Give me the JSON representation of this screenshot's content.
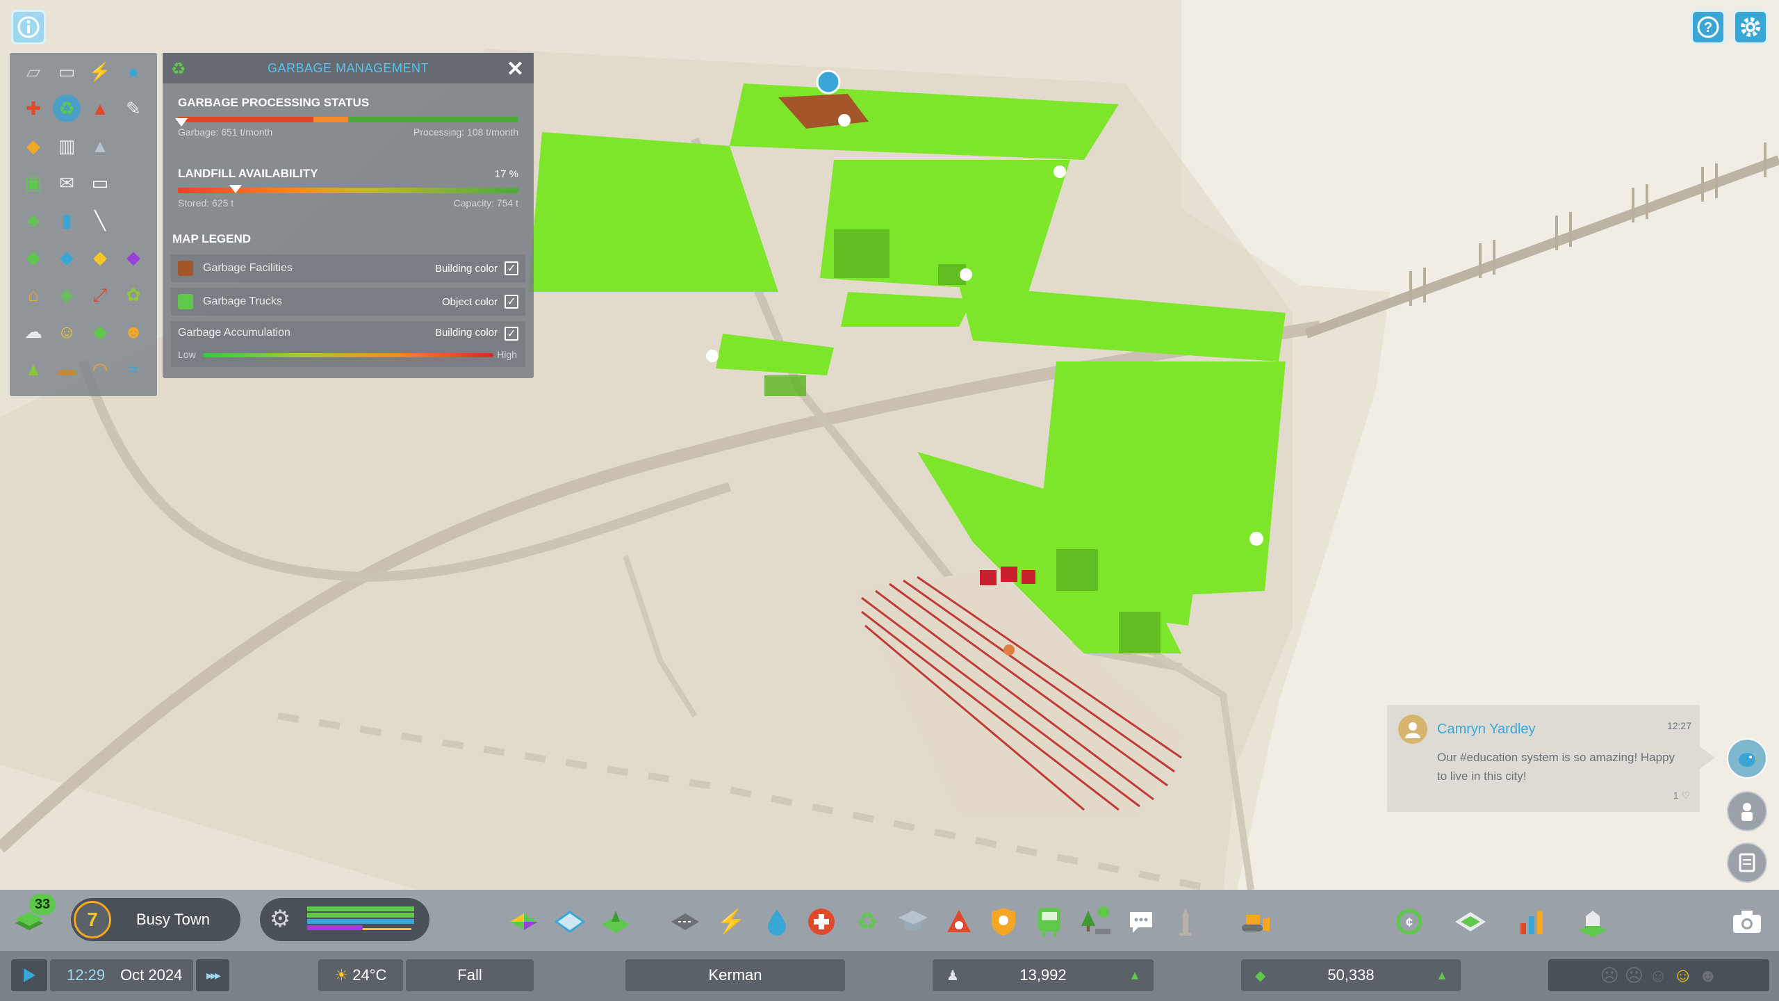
{
  "colors": {
    "accent": "#58c3ee",
    "garbage_facility": "#a4562b",
    "garbage_truck": "#5ec84a",
    "healthy_building": "#7de62a",
    "accumulation_low": "#2ecc40",
    "accumulation_high": "#d42a2a"
  },
  "top_buttons": {
    "info_icon": "info-icon",
    "help_icon": "help-icon",
    "settings_icon": "gear-icon"
  },
  "info_views": [
    [
      "road-icon",
      "transport-icon",
      "electricity-icon",
      "water-icon"
    ],
    [
      "health-icon",
      "garbage-icon",
      "fire-icon",
      "maintenance-icon"
    ],
    [
      "police-icon",
      "government-icon",
      "education-icon",
      ""
    ],
    [
      "public-transport-icon",
      "mail-icon",
      "communication-icon",
      ""
    ],
    [
      "park-icon",
      "trash-can-icon",
      "pipe-icon",
      ""
    ],
    [
      "residential-zone-icon",
      "commercial-zone-icon",
      "industrial-zone-icon",
      "office-zone-icon"
    ],
    [
      "housing-icon",
      "land-value-icon",
      "traffic-icon",
      "pollution-icon"
    ],
    [
      "citizens-icon",
      "happiness-icon",
      "wealth-icon",
      "workers-icon"
    ],
    [
      "terrain-icon",
      "natural-resources-icon",
      "noise-icon",
      "wind-icon"
    ]
  ],
  "garbage_panel": {
    "title": "GARBAGE MANAGEMENT",
    "processing": {
      "title": "GARBAGE PROCESSING STATUS",
      "garbage_label": "Garbage: 651 t/month",
      "processing_label": "Processing: 108 t/month"
    },
    "landfill": {
      "title": "LANDFILL AVAILABILITY",
      "percent": "17 %",
      "fill_fraction": 0.17,
      "stored_label": "Stored: 625 t",
      "capacity_label": "Capacity: 754 t"
    },
    "legend_title": "MAP LEGEND",
    "legend": [
      {
        "label": "Garbage Facilities",
        "type": "Building color",
        "checked": true
      },
      {
        "label": "Garbage Trucks",
        "type": "Object color",
        "checked": true
      },
      {
        "label": "Garbage Accumulation",
        "type": "Building color",
        "checked": true
      }
    ],
    "scale_low": "Low",
    "scale_high": "High"
  },
  "chirper": {
    "name": "Camryn Yardley",
    "time": "12:27",
    "text": "Our #education system is so amazing! Happy to live in this city!",
    "likes": "1"
  },
  "milestone": {
    "badge": "33",
    "level": "7",
    "name": "Busy Town"
  },
  "toolbar_icons": [
    "zoning-icon",
    "area-icon",
    "landscaping-icon",
    "roads-icon",
    "electricity-icon",
    "water-icon",
    "health-icon",
    "garbage-icon",
    "education-icon",
    "fire-icon",
    "police-icon",
    "transport-icon",
    "parks-icon",
    "communications-icon",
    "landmark-icon",
    "bulldozer-icon",
    "economy-icon",
    "map-tiles-icon",
    "statistics-icon",
    "progression-icon",
    "camera-icon"
  ],
  "status": {
    "time": "12:29",
    "date": "Oct 2024",
    "temperature": "24°C",
    "season": "Fall",
    "city": "Kerman",
    "population": "13,992",
    "money": "50,338"
  }
}
